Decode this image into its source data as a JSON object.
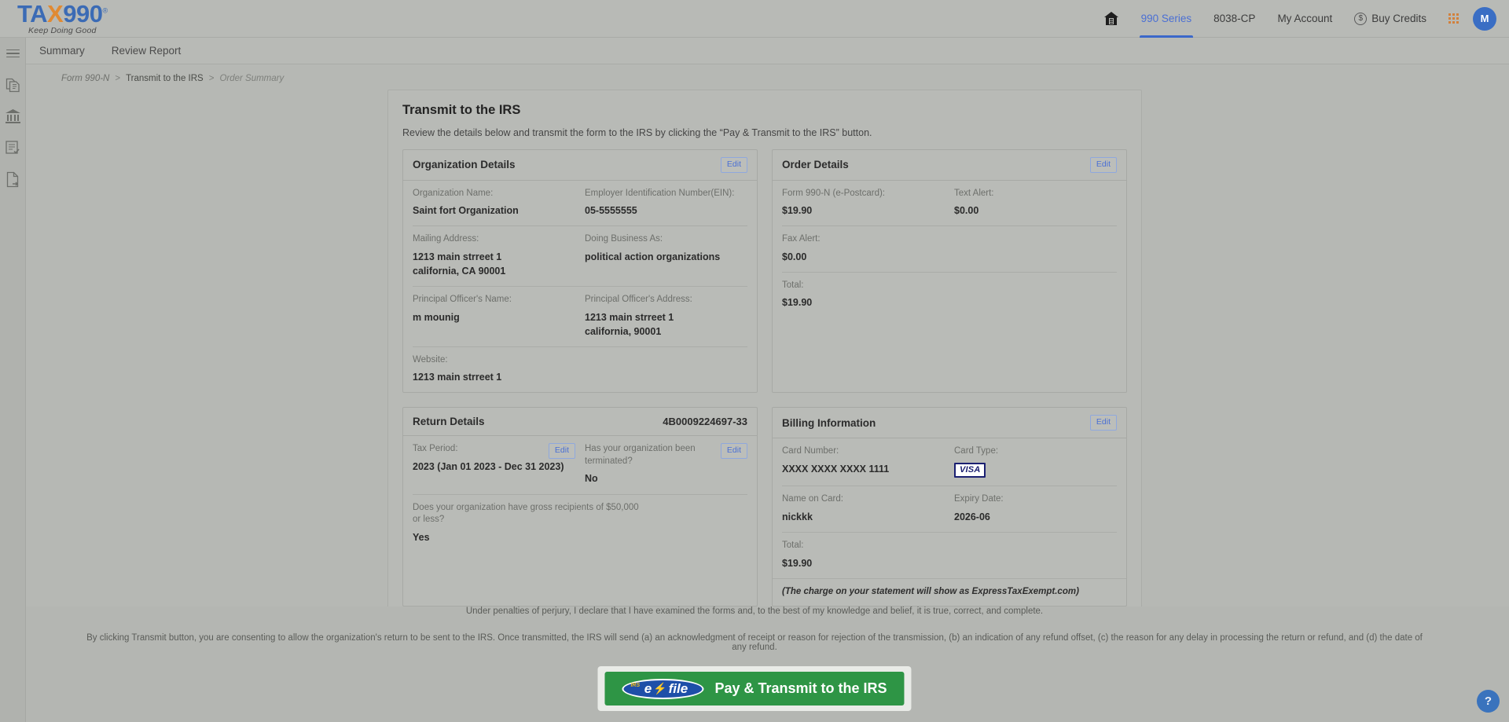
{
  "brand": {
    "logo_prefix": "TA",
    "logo_x": "X",
    "logo_suffix": "990",
    "logo_reg": "®",
    "tagline": "Keep Doing Good"
  },
  "header": {
    "nav": [
      {
        "icon": "home-icon",
        "label": ""
      },
      {
        "icon": "",
        "label": "990 Series"
      },
      {
        "icon": "",
        "label": "8038-CP"
      },
      {
        "icon": "",
        "label": "My Account"
      },
      {
        "icon": "dollar-icon",
        "label": "Buy Credits"
      }
    ],
    "avatar_initial": "M",
    "apps_icon": "grid-apps-icon"
  },
  "tabs": [
    {
      "label": "Summary"
    },
    {
      "label": "Review Report"
    }
  ],
  "sidebar": {
    "items": [
      {
        "icon": "hamburger-menu-icon"
      },
      {
        "icon": "documents-copy-icon"
      },
      {
        "icon": "bank-institution-icon"
      },
      {
        "icon": "checklist-document-icon"
      },
      {
        "icon": "file-export-icon"
      }
    ]
  },
  "breadcrumb": [
    {
      "label": "Form 990-N",
      "type": "link"
    },
    {
      "label": "Transmit to the IRS",
      "type": "mid"
    },
    {
      "label": "Order Summary",
      "type": "current"
    }
  ],
  "panel": {
    "title": "Transmit to the IRS",
    "subtitle": "Review the details below and transmit the form to the IRS by clicking the “Pay & Transmit to the IRS” button."
  },
  "edit_label": "Edit",
  "organization_details": {
    "title": "Organization Details",
    "fields": {
      "org_name_label": "Organization Name:",
      "org_name_value": "Saint fort Organization",
      "ein_label": "Employer Identification Number(EIN):",
      "ein_value": "05-5555555",
      "mailing_label": "Mailing Address:",
      "mailing_line1": "1213 main strreet 1",
      "mailing_line2": "california, CA 90001",
      "dba_label": "Doing Business As:",
      "dba_value": "political action organizations",
      "officer_name_label": "Principal Officer's Name:",
      "officer_name_value": "m mounig",
      "officer_addr_label": "Principal Officer's Address:",
      "officer_addr_line1": "1213 main strreet 1",
      "officer_addr_line2": "california, 90001",
      "website_label": "Website:",
      "website_value": "1213 main strreet 1"
    }
  },
  "order_details": {
    "title": "Order Details",
    "fields": {
      "form_label": "Form 990-N (e-Postcard):",
      "form_value": "$19.90",
      "text_alert_label": "Text Alert:",
      "text_alert_value": "$0.00",
      "fax_alert_label": "Fax Alert:",
      "fax_alert_value": "$0.00",
      "total_label": "Total:",
      "total_value": "$19.90"
    }
  },
  "return_details": {
    "title": "Return Details",
    "return_id": "4B0009224697-33",
    "fields": {
      "tax_period_label": "Tax Period:",
      "tax_period_value": "2023 (Jan 01 2023 - Dec 31 2023)",
      "terminated_label": "Has your organization been terminated?",
      "terminated_value": "No",
      "gross_label": "Does your organization have gross recipients of $50,000 or less?",
      "gross_value": "Yes"
    }
  },
  "billing_information": {
    "title": "Billing Information",
    "fields": {
      "card_number_label": "Card Number:",
      "card_number_value": "XXXX XXXX XXXX 1111",
      "card_type_label": "Card Type:",
      "card_type_value": "VISA",
      "name_on_card_label": "Name on Card:",
      "name_on_card_value": "nickkk",
      "expiry_label": "Expiry Date:",
      "expiry_value": "2026-06",
      "total_label": "Total:",
      "total_value": "$19.90"
    },
    "note": "(The charge on your statement will show as ExpressTaxExempt.com)"
  },
  "legal": {
    "line1": "Under penalties of perjury, I declare that I have examined the forms and, to the best of my knowledge and belief, it is true, correct, and complete.",
    "line2": "By clicking Transmit button, you are consenting to allow the organization's return to be sent to the IRS. Once transmitted, the IRS will send (a) an acknowledgment of receipt or reason for rejection of the transmission, (b) an indication of any refund offset, (c) the reason for any delay in processing the return or refund, and (d) the date of any refund."
  },
  "transmit_button": {
    "label": "Pay & Transmit to the IRS",
    "efile_irs": "IRS",
    "efile_e": "e",
    "efile_bolt": "⚡",
    "efile_file": "file"
  },
  "help": {
    "label": "?"
  },
  "colors": {
    "brand_blue": "#3b6bb5",
    "brand_orange": "#e08a33",
    "accent_blue": "#4a6fd4",
    "green_button": "#2e9545",
    "visa_navy": "#1a1f71",
    "page_bg": "#b4b6b2"
  }
}
